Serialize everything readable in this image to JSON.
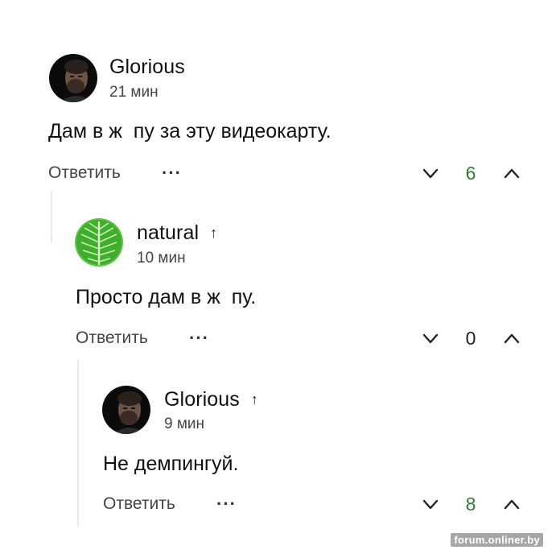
{
  "colors": {
    "positive_score": "#2e7d32",
    "neutral_score": "#222222"
  },
  "comments": [
    {
      "author": "Glorious",
      "time": "21 мин",
      "text": "Дам в ж  пу за эту видеокарту.",
      "reply_label": "Ответить",
      "more_icon": "···",
      "score": "6",
      "score_color": "#2e7d32",
      "is_reply_author_marker": false
    },
    {
      "author": "natural",
      "author_marker": "↑",
      "time": "10 мин",
      "text": "Просто дам в ж  пу.",
      "reply_label": "Ответить",
      "more_icon": "···",
      "score": "0",
      "score_color": "#222222"
    },
    {
      "author": "Glorious",
      "author_marker": "↑",
      "time": "9 мин",
      "text": "Не демпингуй.",
      "reply_label": "Ответить",
      "more_icon": "···",
      "score": "8",
      "score_color": "#2e7d32"
    }
  ],
  "watermark": "forum.onliner.by"
}
